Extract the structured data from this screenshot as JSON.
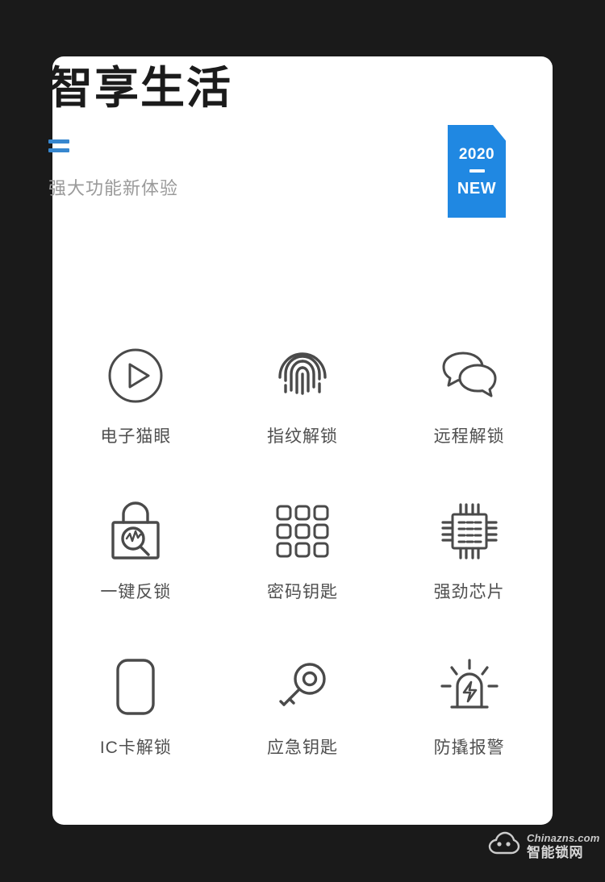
{
  "background_color": "#1a1a1a",
  "card": {
    "background_color": "#ffffff"
  },
  "header": {
    "title": "智享生活",
    "subtitle": "强大功能新体验",
    "accent_color": "#3787cf"
  },
  "badge": {
    "year": "2020",
    "label": "NEW",
    "color": "#2088e2"
  },
  "features": [
    {
      "icon": "play-circle-icon",
      "label": "电子猫眼"
    },
    {
      "icon": "fingerprint-icon",
      "label": "指纹解锁"
    },
    {
      "icon": "chat-bubbles-icon",
      "label": "远程解锁"
    },
    {
      "icon": "padlock-search-icon",
      "label": "一键反锁"
    },
    {
      "icon": "keypad-grid-icon",
      "label": "密码钥匙"
    },
    {
      "icon": "cpu-chip-icon",
      "label": "强劲芯片"
    },
    {
      "icon": "card-icon",
      "label": "IC卡解锁"
    },
    {
      "icon": "key-icon",
      "label": "应急钥匙"
    },
    {
      "icon": "alarm-siren-icon",
      "label": "防撬报警"
    }
  ],
  "watermark": {
    "domain": "Chinazns.com",
    "name": "智能锁网",
    "logo": "cloud-lock-logo"
  },
  "icon_stroke_color": "#4a4a4a"
}
